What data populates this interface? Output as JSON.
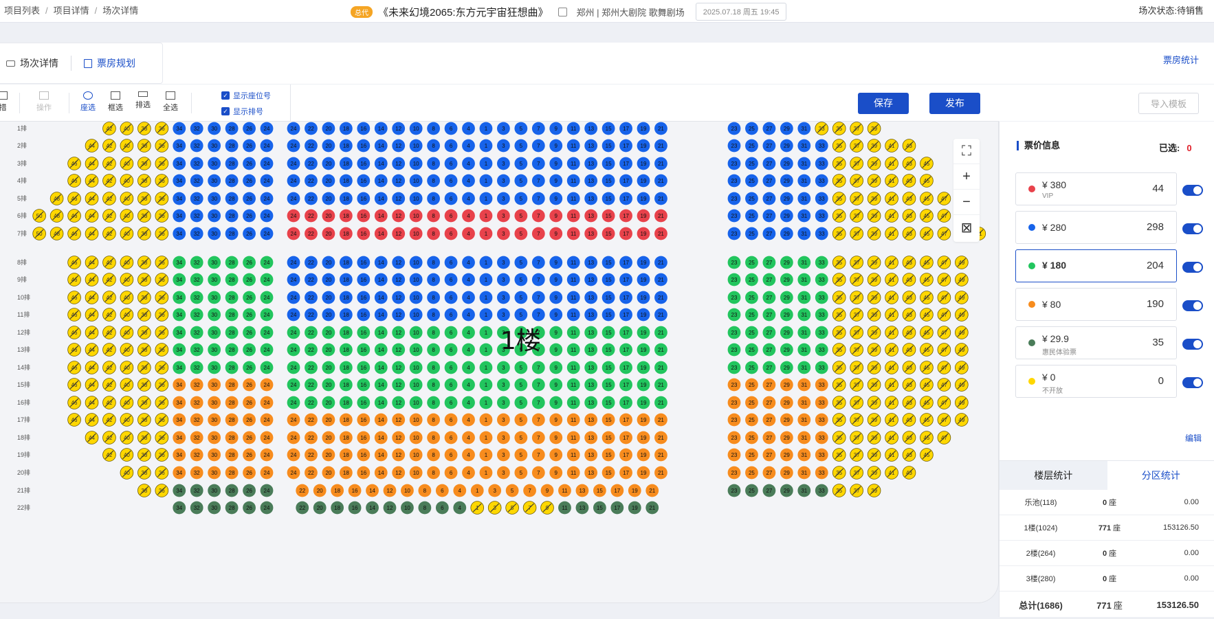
{
  "breadcrumb": {
    "items": [
      "项目列表",
      "项目详情",
      "场次详情"
    ],
    "separator": "/"
  },
  "header": {
    "badge": "总代",
    "title": "《未来幻境2065:东方元宇宙狂想曲》",
    "venue": "郑州 | 郑州大剧院 歌舞剧场",
    "datetime": "2025.07.18 周五 19:45",
    "status": "场次状态:待销售"
  },
  "tabs": [
    {
      "label": "场次详情",
      "icon": "ticket-icon"
    },
    {
      "label": "票房规划",
      "icon": "document-icon"
    }
  ],
  "stats_link": "票房统计",
  "toolbar": {
    "tools": [
      {
        "label": "措",
        "icon": "clear-icon"
      },
      {
        "label": "操作",
        "icon": "edit-icon"
      },
      {
        "label": "座选",
        "icon": "circle-select-icon"
      },
      {
        "label": "框选",
        "icon": "box-select-icon"
      },
      {
        "label": "排选",
        "icon": "row-select-icon"
      },
      {
        "label": "全选",
        "icon": "select-all-icon"
      }
    ],
    "checks": [
      "显示座位号",
      "显示排号"
    ],
    "save": "保存",
    "publish": "发布",
    "import": "导入模板"
  },
  "seat_map": {
    "floor_label": "1楼",
    "rows": [
      "1排",
      "2排",
      "3排",
      "4排",
      "5排",
      "6排",
      "7排",
      "8排",
      "9排",
      "10排",
      "11排",
      "12排",
      "13排",
      "14排",
      "15排",
      "16排",
      "17排",
      "18排",
      "19排",
      "20排",
      "21排",
      "22排"
    ]
  },
  "price_panel": {
    "title": "票价信息",
    "selected_label": "已选:",
    "selected_count": "0",
    "prices": [
      {
        "price": "¥ 380",
        "sub": "VIP",
        "count": "44",
        "color": "#e8424b"
      },
      {
        "price": "¥ 280",
        "sub": "",
        "count": "298",
        "color": "#1763ea"
      },
      {
        "price": "¥ 180",
        "sub": "",
        "count": "204",
        "color": "#22c55e"
      },
      {
        "price": "¥ 80",
        "sub": "",
        "count": "190",
        "color": "#f78c1e"
      },
      {
        "price": "¥ 29.9",
        "sub": "惠民体验票",
        "count": "35",
        "color": "#4a7c59"
      },
      {
        "price": "¥ 0",
        "sub": "不开放",
        "count": "0",
        "color": "#ffd700"
      }
    ],
    "edit": "编辑"
  },
  "stats": {
    "tabs": [
      "楼层统计",
      "分区统计"
    ],
    "rows": [
      {
        "name": "乐池(118)",
        "seats": "0",
        "unit": "座",
        "amount": "0.00"
      },
      {
        "name": "1楼(1024)",
        "seats": "771",
        "unit": "座",
        "amount": "153126.50"
      },
      {
        "name": "2楼(264)",
        "seats": "0",
        "unit": "座",
        "amount": "0.00"
      },
      {
        "name": "3楼(280)",
        "seats": "0",
        "unit": "座",
        "amount": "0.00"
      }
    ],
    "total": {
      "name": "总计(1686)",
      "seats": "771",
      "unit": "座",
      "amount": "153126.50"
    }
  }
}
